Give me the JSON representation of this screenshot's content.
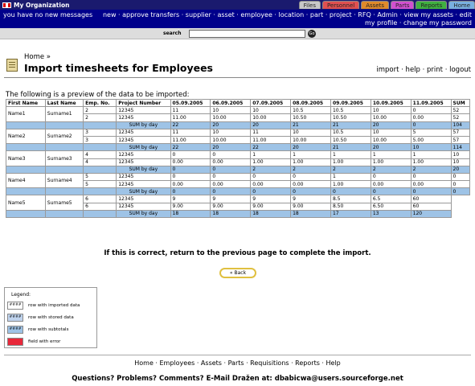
{
  "topbar": {
    "org": "My Organization",
    "tabs": [
      {
        "label": "Files",
        "color": "#c8c8c8"
      },
      {
        "label": "Personnel",
        "color": "#e05050"
      },
      {
        "label": "Assets",
        "color": "#e08a2a"
      },
      {
        "label": "Parts",
        "color": "#d050d0"
      },
      {
        "label": "Reports",
        "color": "#40b040"
      },
      {
        "label": "Home",
        "color": "#7ab0e0"
      }
    ]
  },
  "nav": {
    "left": "you have no new messages",
    "right": "new · approve transfers · supplier · asset · employee · location · part · project · RFQ · Admin · view my assets · edit my profile · change my password"
  },
  "search": {
    "label": "search",
    "go": "Go"
  },
  "header": {
    "crumb": "Home »",
    "title": "Import timesheets for Employees",
    "links": "import · help · print · logout"
  },
  "preview_text": "The following is a preview of the data to be imported:",
  "table": {
    "headers": [
      "First Name",
      "Last Name",
      "Emp. No.",
      "Project Number",
      "05.09.2005",
      "06.09.2005",
      "07.09.2005",
      "08.09.2005",
      "09.09.2005",
      "10.09.2005",
      "11.09.2005",
      "SUM"
    ],
    "sum_label": "SUM by day",
    "groups": [
      {
        "first": "Name1",
        "last": "Surname1",
        "rows": [
          [
            "2",
            "12345",
            "11",
            "10",
            "10",
            "10.5",
            "10.5",
            "10",
            "0",
            "52"
          ],
          [
            "2",
            "12345",
            "11.00",
            "10.00",
            "10.00",
            "10.50",
            "10.50",
            "10.00",
            "0.00",
            "52"
          ]
        ],
        "sum": [
          "22",
          "20",
          "20",
          "21",
          "21",
          "20",
          "0",
          "104"
        ]
      },
      {
        "first": "Name2",
        "last": "Surname2",
        "rows": [
          [
            "3",
            "12345",
            "11",
            "10",
            "11",
            "10",
            "10.5",
            "10",
            "5",
            "57"
          ],
          [
            "3",
            "12345",
            "11.00",
            "10.00",
            "11.00",
            "10.00",
            "10.50",
            "10.00",
            "5.00",
            "57"
          ]
        ],
        "sum": [
          "22",
          "20",
          "22",
          "20",
          "21",
          "20",
          "10",
          "114"
        ]
      },
      {
        "first": "Name3",
        "last": "Surname3",
        "rows": [
          [
            "4",
            "12345",
            "0",
            "0",
            "1",
            "1",
            "1",
            "1",
            "1",
            "10"
          ],
          [
            "4",
            "12345",
            "0.00",
            "0.00",
            "1.00",
            "1.00",
            "1.00",
            "1.00",
            "1.00",
            "10"
          ]
        ],
        "sum": [
          "0",
          "0",
          "2",
          "2",
          "2",
          "2",
          "2",
          "20"
        ]
      },
      {
        "first": "Name4",
        "last": "Surname4",
        "rows": [
          [
            "5",
            "12345",
            "0",
            "0",
            "0",
            "0",
            "1",
            "0",
            "0",
            "0"
          ],
          [
            "5",
            "12345",
            "0.00",
            "0.00",
            "0.00",
            "0.00",
            "1.00",
            "0.00",
            "0.00",
            "0"
          ]
        ],
        "sum": [
          "0",
          "0",
          "0",
          "0",
          "0",
          "0",
          "0",
          "0"
        ]
      },
      {
        "first": "Name5",
        "last": "Surname5",
        "rows": [
          [
            "6",
            "12345",
            "9",
            "9",
            "9",
            "9",
            "8.5",
            "6.5",
            "60"
          ],
          [
            "6",
            "12345",
            "9.00",
            "9.00",
            "9.00",
            "9.00",
            "8.50",
            "6.50",
            "60"
          ]
        ],
        "sum": [
          "18",
          "18",
          "18",
          "18",
          "17",
          "13",
          "120"
        ]
      }
    ]
  },
  "confirm_text": "If this is correct, return to the previous page to complete the import.",
  "back_label": "« Back",
  "legend": {
    "title": "Legend:",
    "items": [
      {
        "swatch": "####",
        "label": "row with imported data",
        "color": "#ffffff"
      },
      {
        "swatch": "####",
        "label": "row with stored data",
        "color": "#c0d4ee"
      },
      {
        "swatch": "####",
        "label": "row with subtotals",
        "color": "#9ec3e6"
      },
      {
        "swatch": "",
        "label": "field with error",
        "color": "#e8283a"
      }
    ]
  },
  "footer": {
    "links": "Home · Employees · Assets · Parts · Requisitions · Reports · Help",
    "contact": "Questions? Problems? Comments? E-Mail Dražen at: dbabicwa@users.sourceforge.net"
  }
}
